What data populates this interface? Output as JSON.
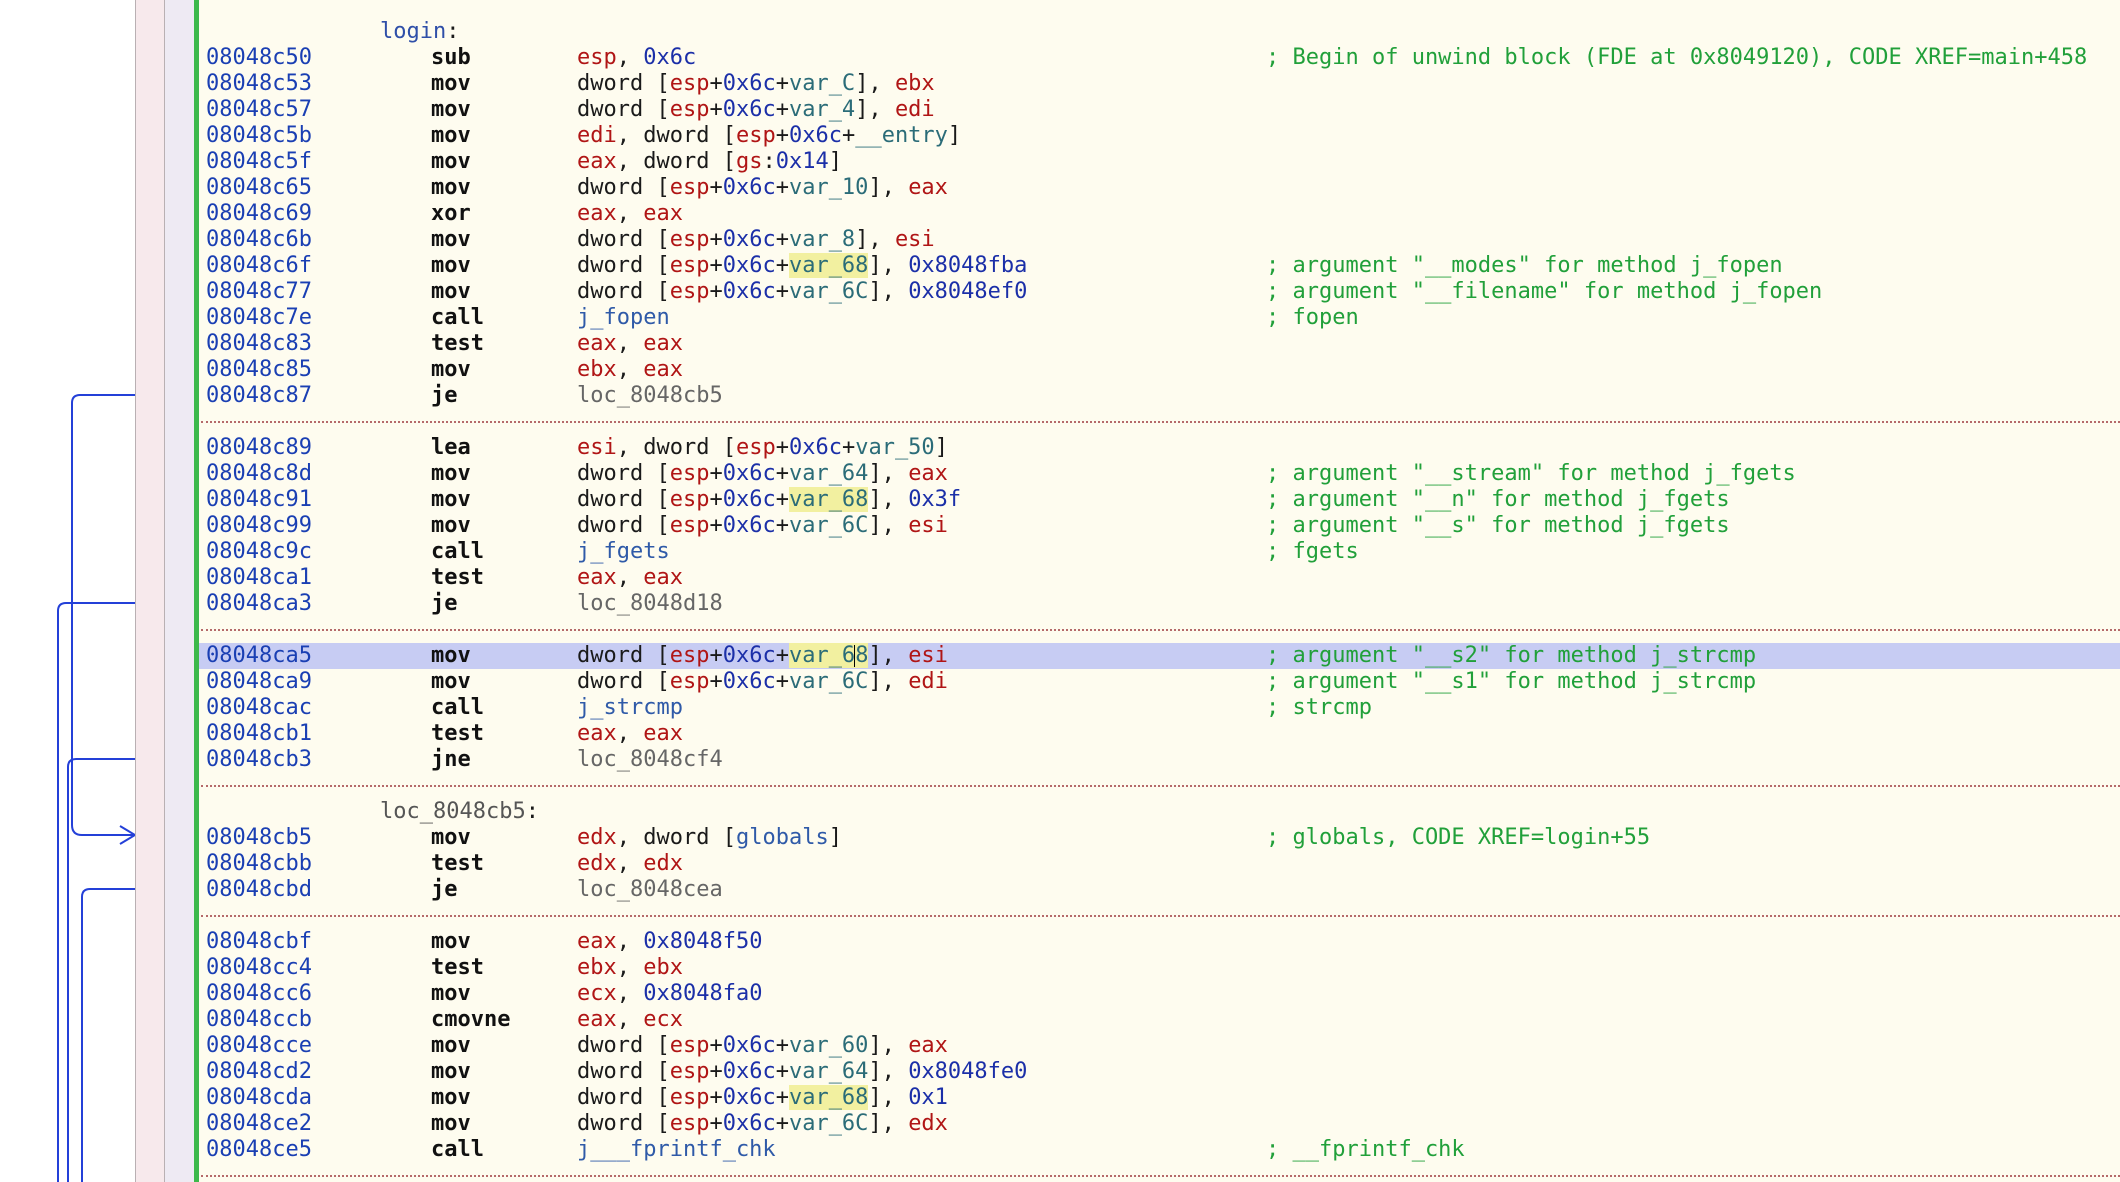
{
  "colors": {
    "code_bg": "#fefcef",
    "address": "#1a3fb3",
    "register": "#b01515",
    "variable": "#2b6c78",
    "number": "#1b2fa8",
    "comment": "#21a03a",
    "highlight_row": "#c7ccf3",
    "arrows": "#2440d8",
    "green_bar": "#3cb94a"
  },
  "listing": {
    "rows": [
      {
        "type": "label",
        "text": "login",
        "style": "named"
      },
      {
        "type": "ins",
        "addr": "08048c50",
        "mn": "sub",
        "ops": [
          [
            "reg",
            "esp"
          ],
          [
            "p",
            ", "
          ],
          [
            "num",
            "0x6c"
          ]
        ],
        "cmt": "; Begin of unwind block (FDE at 0x8049120), CODE XREF=main+458"
      },
      {
        "type": "ins",
        "addr": "08048c53",
        "mn": "mov",
        "ops": [
          [
            "p",
            "dword ["
          ],
          [
            "reg",
            "esp"
          ],
          [
            "p",
            "+"
          ],
          [
            "num",
            "0x6c"
          ],
          [
            "p",
            "+"
          ],
          [
            "var",
            "var_C"
          ],
          [
            "p",
            "], "
          ],
          [
            "reg",
            "ebx"
          ]
        ]
      },
      {
        "type": "ins",
        "addr": "08048c57",
        "mn": "mov",
        "ops": [
          [
            "p",
            "dword ["
          ],
          [
            "reg",
            "esp"
          ],
          [
            "p",
            "+"
          ],
          [
            "num",
            "0x6c"
          ],
          [
            "p",
            "+"
          ],
          [
            "var",
            "var_4"
          ],
          [
            "p",
            "], "
          ],
          [
            "reg",
            "edi"
          ]
        ]
      },
      {
        "type": "ins",
        "addr": "08048c5b",
        "mn": "mov",
        "ops": [
          [
            "reg",
            "edi"
          ],
          [
            "p",
            ", dword ["
          ],
          [
            "reg",
            "esp"
          ],
          [
            "p",
            "+"
          ],
          [
            "num",
            "0x6c"
          ],
          [
            "p",
            "+"
          ],
          [
            "var",
            "__entry"
          ],
          [
            "p",
            "]"
          ]
        ]
      },
      {
        "type": "ins",
        "addr": "08048c5f",
        "mn": "mov",
        "ops": [
          [
            "reg",
            "eax"
          ],
          [
            "p",
            ", dword ["
          ],
          [
            "reg",
            "gs"
          ],
          [
            "p",
            ":"
          ],
          [
            "num",
            "0x14"
          ],
          [
            "p",
            "]"
          ]
        ]
      },
      {
        "type": "ins",
        "addr": "08048c65",
        "mn": "mov",
        "ops": [
          [
            "p",
            "dword ["
          ],
          [
            "reg",
            "esp"
          ],
          [
            "p",
            "+"
          ],
          [
            "num",
            "0x6c"
          ],
          [
            "p",
            "+"
          ],
          [
            "var",
            "var_10"
          ],
          [
            "p",
            "], "
          ],
          [
            "reg",
            "eax"
          ]
        ]
      },
      {
        "type": "ins",
        "addr": "08048c69",
        "mn": "xor",
        "ops": [
          [
            "reg",
            "eax"
          ],
          [
            "p",
            ", "
          ],
          [
            "reg",
            "eax"
          ]
        ]
      },
      {
        "type": "ins",
        "addr": "08048c6b",
        "mn": "mov",
        "ops": [
          [
            "p",
            "dword ["
          ],
          [
            "reg",
            "esp"
          ],
          [
            "p",
            "+"
          ],
          [
            "num",
            "0x6c"
          ],
          [
            "p",
            "+"
          ],
          [
            "var",
            "var_8"
          ],
          [
            "p",
            "], "
          ],
          [
            "reg",
            "esi"
          ]
        ]
      },
      {
        "type": "ins",
        "addr": "08048c6f",
        "mn": "mov",
        "ops": [
          [
            "p",
            "dword ["
          ],
          [
            "reg",
            "esp"
          ],
          [
            "p",
            "+"
          ],
          [
            "num",
            "0x6c"
          ],
          [
            "p",
            "+"
          ],
          [
            "varhl",
            "var_68"
          ],
          [
            "p",
            "], "
          ],
          [
            "num",
            "0x8048fba"
          ]
        ],
        "cmt": "; argument \"__modes\" for method j_fopen"
      },
      {
        "type": "ins",
        "addr": "08048c77",
        "mn": "mov",
        "ops": [
          [
            "p",
            "dword ["
          ],
          [
            "reg",
            "esp"
          ],
          [
            "p",
            "+"
          ],
          [
            "num",
            "0x6c"
          ],
          [
            "p",
            "+"
          ],
          [
            "var",
            "var_6C"
          ],
          [
            "p",
            "], "
          ],
          [
            "num",
            "0x8048ef0"
          ]
        ],
        "cmt": "; argument \"__filename\" for method j_fopen"
      },
      {
        "type": "ins",
        "addr": "08048c7e",
        "mn": "call",
        "ops": [
          [
            "fn",
            "j_fopen"
          ]
        ],
        "cmt": "; fopen"
      },
      {
        "type": "ins",
        "addr": "08048c83",
        "mn": "test",
        "ops": [
          [
            "reg",
            "eax"
          ],
          [
            "p",
            ", "
          ],
          [
            "reg",
            "eax"
          ]
        ]
      },
      {
        "type": "ins",
        "addr": "08048c85",
        "mn": "mov",
        "ops": [
          [
            "reg",
            "ebx"
          ],
          [
            "p",
            ", "
          ],
          [
            "reg",
            "eax"
          ]
        ]
      },
      {
        "type": "ins",
        "addr": "08048c87",
        "mn": "je",
        "ops": [
          [
            "loc",
            "loc_8048cb5"
          ]
        ]
      },
      {
        "type": "sep"
      },
      {
        "type": "ins",
        "addr": "08048c89",
        "mn": "lea",
        "ops": [
          [
            "reg",
            "esi"
          ],
          [
            "p",
            ", dword ["
          ],
          [
            "reg",
            "esp"
          ],
          [
            "p",
            "+"
          ],
          [
            "num",
            "0x6c"
          ],
          [
            "p",
            "+"
          ],
          [
            "var",
            "var_50"
          ],
          [
            "p",
            "]"
          ]
        ]
      },
      {
        "type": "ins",
        "addr": "08048c8d",
        "mn": "mov",
        "ops": [
          [
            "p",
            "dword ["
          ],
          [
            "reg",
            "esp"
          ],
          [
            "p",
            "+"
          ],
          [
            "num",
            "0x6c"
          ],
          [
            "p",
            "+"
          ],
          [
            "var",
            "var_64"
          ],
          [
            "p",
            "], "
          ],
          [
            "reg",
            "eax"
          ]
        ],
        "cmt": "; argument \"__stream\" for method j_fgets"
      },
      {
        "type": "ins",
        "addr": "08048c91",
        "mn": "mov",
        "ops": [
          [
            "p",
            "dword ["
          ],
          [
            "reg",
            "esp"
          ],
          [
            "p",
            "+"
          ],
          [
            "num",
            "0x6c"
          ],
          [
            "p",
            "+"
          ],
          [
            "varhl",
            "var_68"
          ],
          [
            "p",
            "], "
          ],
          [
            "num",
            "0x3f"
          ]
        ],
        "cmt": "; argument \"__n\" for method j_fgets"
      },
      {
        "type": "ins",
        "addr": "08048c99",
        "mn": "mov",
        "ops": [
          [
            "p",
            "dword ["
          ],
          [
            "reg",
            "esp"
          ],
          [
            "p",
            "+"
          ],
          [
            "num",
            "0x6c"
          ],
          [
            "p",
            "+"
          ],
          [
            "var",
            "var_6C"
          ],
          [
            "p",
            "], "
          ],
          [
            "reg",
            "esi"
          ]
        ],
        "cmt": "; argument \"__s\" for method j_fgets"
      },
      {
        "type": "ins",
        "addr": "08048c9c",
        "mn": "call",
        "ops": [
          [
            "fn",
            "j_fgets"
          ]
        ],
        "cmt": "; fgets"
      },
      {
        "type": "ins",
        "addr": "08048ca1",
        "mn": "test",
        "ops": [
          [
            "reg",
            "eax"
          ],
          [
            "p",
            ", "
          ],
          [
            "reg",
            "eax"
          ]
        ]
      },
      {
        "type": "ins",
        "addr": "08048ca3",
        "mn": "je",
        "ops": [
          [
            "loc",
            "loc_8048d18"
          ]
        ]
      },
      {
        "type": "sep"
      },
      {
        "type": "ins",
        "hl": true,
        "addr": "08048ca5",
        "mn": "mov",
        "ops": [
          [
            "p",
            "dword ["
          ],
          [
            "reg",
            "esp"
          ],
          [
            "p",
            "+"
          ],
          [
            "num",
            "0x6c"
          ],
          [
            "p",
            "+"
          ],
          [
            "varhl",
            "var_6"
          ],
          [
            "cursor",
            ""
          ],
          [
            "varhl",
            "8"
          ],
          [
            "p",
            "], "
          ],
          [
            "reg",
            "esi"
          ]
        ],
        "cmt": "; argument \"__s2\" for method j_strcmp"
      },
      {
        "type": "ins",
        "addr": "08048ca9",
        "mn": "mov",
        "ops": [
          [
            "p",
            "dword ["
          ],
          [
            "reg",
            "esp"
          ],
          [
            "p",
            "+"
          ],
          [
            "num",
            "0x6c"
          ],
          [
            "p",
            "+"
          ],
          [
            "var",
            "var_6C"
          ],
          [
            "p",
            "], "
          ],
          [
            "reg",
            "edi"
          ]
        ],
        "cmt": "; argument \"__s1\" for method j_strcmp"
      },
      {
        "type": "ins",
        "addr": "08048cac",
        "mn": "call",
        "ops": [
          [
            "fn",
            "j_strcmp"
          ]
        ],
        "cmt": "; strcmp"
      },
      {
        "type": "ins",
        "addr": "08048cb1",
        "mn": "test",
        "ops": [
          [
            "reg",
            "eax"
          ],
          [
            "p",
            ", "
          ],
          [
            "reg",
            "eax"
          ]
        ]
      },
      {
        "type": "ins",
        "addr": "08048cb3",
        "mn": "jne",
        "ops": [
          [
            "loc",
            "loc_8048cf4"
          ]
        ]
      },
      {
        "type": "sep"
      },
      {
        "type": "label",
        "text": "loc_8048cb5",
        "style": "loc"
      },
      {
        "type": "ins",
        "addr": "08048cb5",
        "mn": "mov",
        "ops": [
          [
            "reg",
            "edx"
          ],
          [
            "p",
            ", dword ["
          ],
          [
            "fn",
            "globals"
          ],
          [
            "p",
            "]"
          ]
        ],
        "cmt": "; globals, CODE XREF=login+55"
      },
      {
        "type": "ins",
        "addr": "08048cbb",
        "mn": "test",
        "ops": [
          [
            "reg",
            "edx"
          ],
          [
            "p",
            ", "
          ],
          [
            "reg",
            "edx"
          ]
        ]
      },
      {
        "type": "ins",
        "addr": "08048cbd",
        "mn": "je",
        "ops": [
          [
            "loc",
            "loc_8048cea"
          ]
        ]
      },
      {
        "type": "sep"
      },
      {
        "type": "ins",
        "addr": "08048cbf",
        "mn": "mov",
        "ops": [
          [
            "reg",
            "eax"
          ],
          [
            "p",
            ", "
          ],
          [
            "num",
            "0x8048f50"
          ]
        ]
      },
      {
        "type": "ins",
        "addr": "08048cc4",
        "mn": "test",
        "ops": [
          [
            "reg",
            "ebx"
          ],
          [
            "p",
            ", "
          ],
          [
            "reg",
            "ebx"
          ]
        ]
      },
      {
        "type": "ins",
        "addr": "08048cc6",
        "mn": "mov",
        "ops": [
          [
            "reg",
            "ecx"
          ],
          [
            "p",
            ", "
          ],
          [
            "num",
            "0x8048fa0"
          ]
        ]
      },
      {
        "type": "ins",
        "addr": "08048ccb",
        "mn": "cmovne",
        "ops": [
          [
            "reg",
            "eax"
          ],
          [
            "p",
            ", "
          ],
          [
            "reg",
            "ecx"
          ]
        ]
      },
      {
        "type": "ins",
        "addr": "08048cce",
        "mn": "mov",
        "ops": [
          [
            "p",
            "dword ["
          ],
          [
            "reg",
            "esp"
          ],
          [
            "p",
            "+"
          ],
          [
            "num",
            "0x6c"
          ],
          [
            "p",
            "+"
          ],
          [
            "var",
            "var_60"
          ],
          [
            "p",
            "], "
          ],
          [
            "reg",
            "eax"
          ]
        ]
      },
      {
        "type": "ins",
        "addr": "08048cd2",
        "mn": "mov",
        "ops": [
          [
            "p",
            "dword ["
          ],
          [
            "reg",
            "esp"
          ],
          [
            "p",
            "+"
          ],
          [
            "num",
            "0x6c"
          ],
          [
            "p",
            "+"
          ],
          [
            "var",
            "var_64"
          ],
          [
            "p",
            "], "
          ],
          [
            "num",
            "0x8048fe0"
          ]
        ]
      },
      {
        "type": "ins",
        "addr": "08048cda",
        "mn": "mov",
        "ops": [
          [
            "p",
            "dword ["
          ],
          [
            "reg",
            "esp"
          ],
          [
            "p",
            "+"
          ],
          [
            "num",
            "0x6c"
          ],
          [
            "p",
            "+"
          ],
          [
            "varhl",
            "var_68"
          ],
          [
            "p",
            "], "
          ],
          [
            "num",
            "0x1"
          ]
        ]
      },
      {
        "type": "ins",
        "addr": "08048ce2",
        "mn": "mov",
        "ops": [
          [
            "p",
            "dword ["
          ],
          [
            "reg",
            "esp"
          ],
          [
            "p",
            "+"
          ],
          [
            "num",
            "0x6c"
          ],
          [
            "p",
            "+"
          ],
          [
            "var",
            "var_6C"
          ],
          [
            "p",
            "], "
          ],
          [
            "reg",
            "edx"
          ]
        ]
      },
      {
        "type": "ins",
        "addr": "08048ce5",
        "mn": "call",
        "ops": [
          [
            "fn",
            "j___fprintf_chk"
          ]
        ],
        "cmt": "; __fprintf_chk"
      },
      {
        "type": "sep"
      }
    ]
  }
}
